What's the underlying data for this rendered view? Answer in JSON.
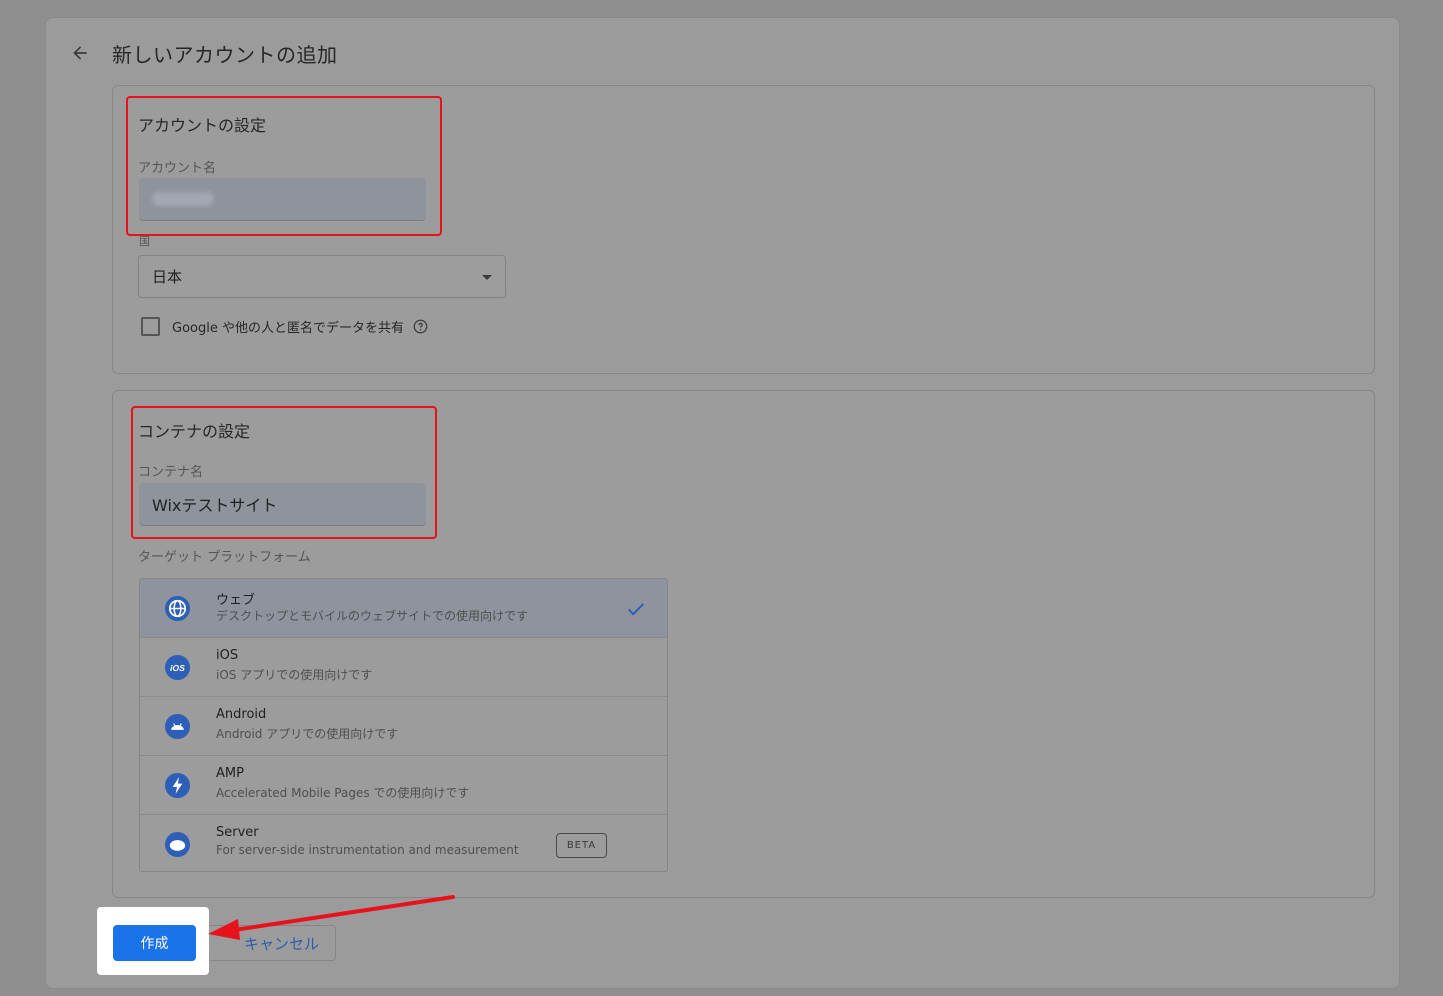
{
  "header": {
    "title": "新しいアカウントの追加",
    "back_icon": "arrow-back-icon"
  },
  "account_settings": {
    "title": "アカウントの設定",
    "account_name_label": "アカウント名",
    "account_name_value": "",
    "country_label": "国",
    "country_value": "日本",
    "share_data_label": "Google や他の人と匿名でデータを共有",
    "share_data_checked": false
  },
  "container_settings": {
    "title": "コンテナの設定",
    "container_name_label": "コンテナ名",
    "container_name_value": "Wixテストサイト",
    "target_platform_label": "ターゲット プラットフォーム"
  },
  "platforms": [
    {
      "name": "ウェブ",
      "desc": "デスクトップとモバイルのウェブサイトでの使用向けです",
      "icon": "globe-icon",
      "selected": true
    },
    {
      "name": "iOS",
      "desc": "iOS アプリでの使用向けです",
      "icon": "ios-icon",
      "selected": false
    },
    {
      "name": "Android",
      "desc": "Android アプリでの使用向けです",
      "icon": "android-icon",
      "selected": false
    },
    {
      "name": "AMP",
      "desc": "Accelerated Mobile Pages での使用向けです",
      "icon": "amp-icon",
      "selected": false
    },
    {
      "name": "Server",
      "desc": "For server-side instrumentation and measurement",
      "icon": "cloud-icon",
      "selected": false,
      "badge": "BETA"
    }
  ],
  "footer": {
    "create_label": "作成",
    "cancel_label": "キャンセル"
  },
  "colors": {
    "primary": "#1a73e8",
    "annotation_red": "#e8121d"
  }
}
